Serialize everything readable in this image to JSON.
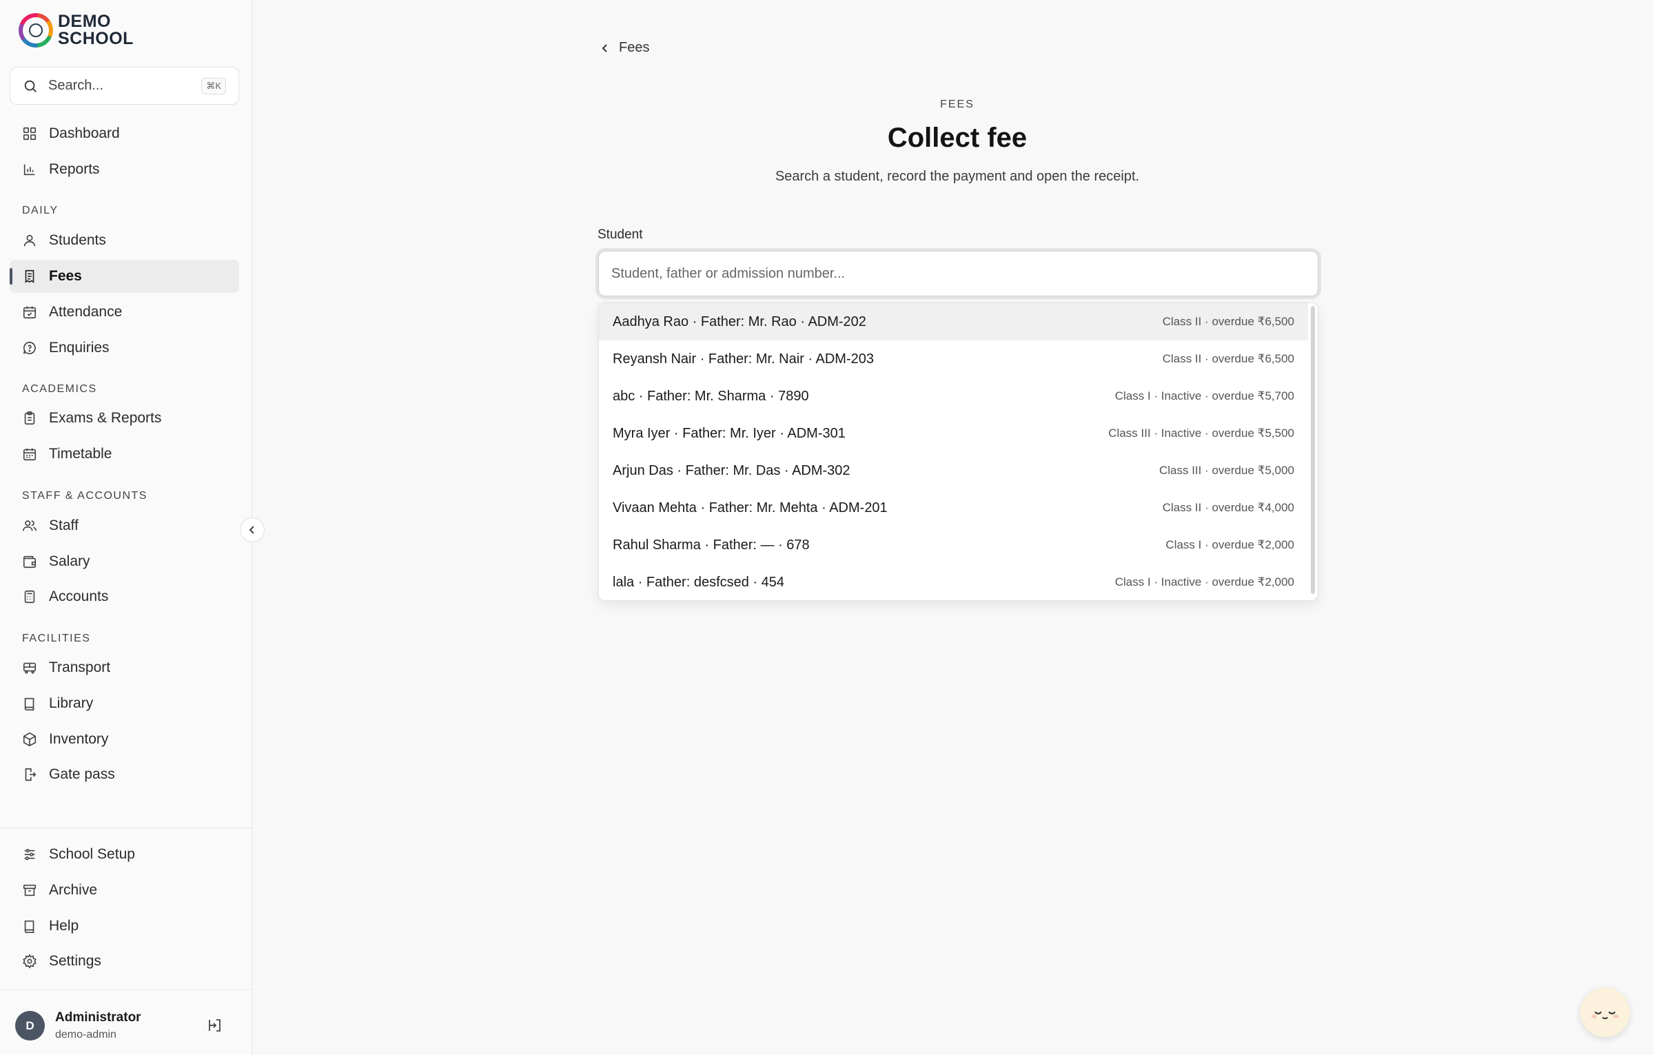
{
  "brand": {
    "line1": "DEMO",
    "line2": "SCHOOL"
  },
  "sidebar": {
    "search_placeholder": "Search...",
    "search_shortcut": "⌘K",
    "items": {
      "dashboard": "Dashboard",
      "reports": "Reports",
      "students": "Students",
      "fees": "Fees",
      "attendance": "Attendance",
      "enquiries": "Enquiries",
      "exams": "Exams & Reports",
      "timetable": "Timetable",
      "staff": "Staff",
      "salary": "Salary",
      "accounts": "Accounts",
      "transport": "Transport",
      "library": "Library",
      "inventory": "Inventory",
      "gatepass": "Gate pass",
      "setup": "School Setup",
      "archive": "Archive",
      "help": "Help",
      "settings": "Settings"
    },
    "sections": {
      "daily": "DAILY",
      "academics": "ACADEMICS",
      "staff_accounts": "STAFF & ACCOUNTS",
      "facilities": "FACILITIES"
    },
    "active_item": "Fees"
  },
  "user": {
    "initial": "D",
    "name": "Administrator",
    "username": "demo-admin"
  },
  "page": {
    "back_label": "Fees",
    "eyebrow": "FEES",
    "title": "Collect fee",
    "subtitle": "Search a student, record the payment and open the receipt.",
    "field_label": "Student",
    "input_placeholder": "Student, father or admission number...",
    "input_value": ""
  },
  "results": [
    {
      "main": "Aadhya Rao · Father: Mr. Rao · ADM-202",
      "meta": "Class II · overdue ₹6,500"
    },
    {
      "main": "Reyansh Nair · Father: Mr. Nair · ADM-203",
      "meta": "Class II · overdue ₹6,500"
    },
    {
      "main": "abc · Father: Mr. Sharma · 7890",
      "meta": "Class I · Inactive · overdue ₹5,700"
    },
    {
      "main": "Myra Iyer · Father: Mr. Iyer · ADM-301",
      "meta": "Class III · Inactive · overdue ₹5,500"
    },
    {
      "main": "Arjun Das · Father: Mr. Das · ADM-302",
      "meta": "Class III · overdue ₹5,000"
    },
    {
      "main": "Vivaan Mehta · Father: Mr. Mehta · ADM-201",
      "meta": "Class II · overdue ₹4,000"
    },
    {
      "main": "Rahul Sharma · Father: — · 678",
      "meta": "Class I · overdue ₹2,000"
    },
    {
      "main": "lala · Father: desfcsed · 454",
      "meta": "Class I · Inactive · overdue ₹2,000"
    }
  ],
  "colors": {
    "accent": "#4b5563",
    "highlight": "#f0f0f0",
    "background": "#f8f8f8"
  },
  "icons": [
    "search-icon",
    "dashboard-icon",
    "bar-chart-icon",
    "user-icon",
    "receipt-icon",
    "calendar-check-icon",
    "message-icon",
    "clipboard-icon",
    "calendar-icon",
    "users-icon",
    "wallet-icon",
    "calculator-icon",
    "bus-icon",
    "book-icon",
    "box-icon",
    "door-icon",
    "sliders-icon",
    "archive-icon",
    "settings-icon",
    "logout-icon",
    "chevron-left-icon",
    "assistant-face-icon"
  ]
}
